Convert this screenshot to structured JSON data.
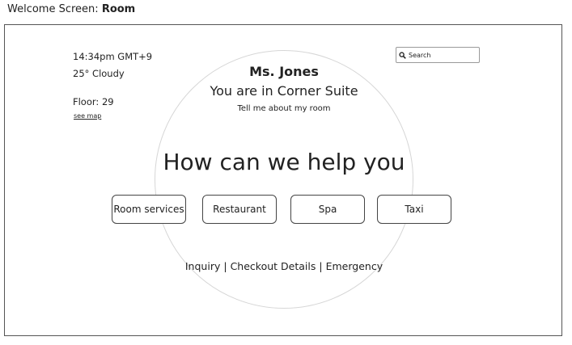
{
  "page": {
    "title_prefix": "Welcome Screen: ",
    "title_bold": "Room"
  },
  "status": {
    "time": "14:34pm GMT+9",
    "weather": "25° Cloudy",
    "floor": "Floor: 29",
    "see_map": "see map"
  },
  "search": {
    "placeholder": "Search",
    "icon": "search-icon"
  },
  "greeting": {
    "guest_name": "Ms. Jones",
    "location": "You are in Corner Suite",
    "tell_me": "Tell me about my room"
  },
  "help": {
    "heading": "How can we help you"
  },
  "services": [
    {
      "label": "Room services"
    },
    {
      "label": "Restaurant"
    },
    {
      "label": "Spa"
    },
    {
      "label": "Taxi"
    }
  ],
  "footer_links": [
    {
      "label": "Inquiry"
    },
    {
      "label": "Checkout Details"
    },
    {
      "label": "Emergency"
    }
  ],
  "footer_separator": "|"
}
